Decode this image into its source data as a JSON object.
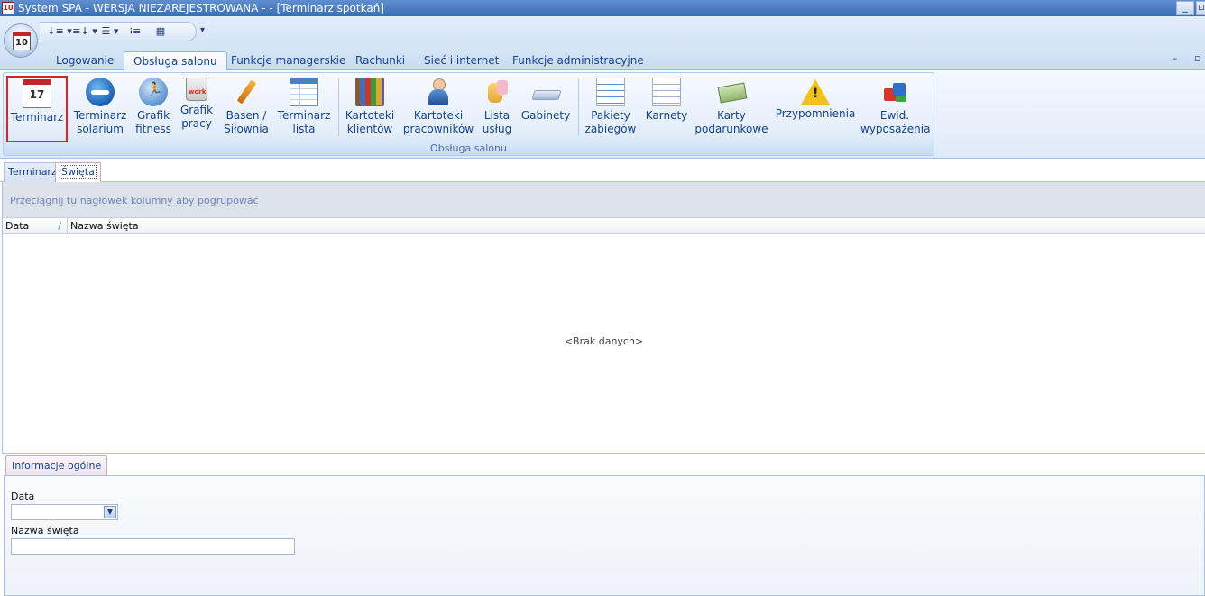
{
  "window": {
    "title": "System SPA - WERSJA NIEZAREJESTROWANA -  - [Terminarz spotkań]",
    "app_icon_text": "10",
    "controls": {
      "minimize": "_",
      "restore": "▫"
    }
  },
  "orb": {
    "day": "10"
  },
  "qat": {
    "buttons": [
      "↓≡ ▾",
      "≡↓ ▾",
      "☰ ▾",
      "⁝≡",
      "▦"
    ],
    "more": "▾"
  },
  "tabs": [
    {
      "label": "Logowanie"
    },
    {
      "label": "Obsługa salonu"
    },
    {
      "label": "Funkcje managerskie"
    },
    {
      "label": "Rachunki"
    },
    {
      "label": "Sieć i internet"
    },
    {
      "label": "Funkcje administracyjne"
    }
  ],
  "tabs_controls": {
    "min": "–",
    "restore": "▫"
  },
  "ribbon": {
    "group_label": "Obsługa salonu",
    "buttons": [
      {
        "label": "Terminarz",
        "icon": "calendar-icon",
        "icon_text": "17"
      },
      {
        "label": "Terminarz solarium",
        "icon": "solarium-icon"
      },
      {
        "label": "Grafik fitness",
        "icon": "runner-icon"
      },
      {
        "label": "Grafik pracy",
        "icon": "work-mug-icon"
      },
      {
        "label": "Basen / Siłownia",
        "icon": "pencil-icon"
      },
      {
        "label": "Terminarz lista",
        "icon": "table-icon"
      },
      {
        "label": "Kartoteki klientów",
        "icon": "books-icon"
      },
      {
        "label": "Kartoteki pracowników",
        "icon": "person-icon"
      },
      {
        "label": "Lista usług",
        "icon": "hand-icon"
      },
      {
        "label": "Gabinety",
        "icon": "bed-icon"
      },
      {
        "label": "Pakiety zabiegów",
        "icon": "checklist-icon"
      },
      {
        "label": "Karnety",
        "icon": "list-icon"
      },
      {
        "label": "Karty podarunkowe",
        "icon": "money-icon"
      },
      {
        "label": "Przypomnienia",
        "icon": "warning-icon"
      },
      {
        "label": "Ewid. wyposażenia",
        "icon": "cubes-icon"
      }
    ]
  },
  "doc_tabs": [
    {
      "label": "Terminarz"
    },
    {
      "label": "Święta"
    }
  ],
  "grid": {
    "group_hint": "Przeciągnij tu nagłówek kolumny aby pogrupować",
    "columns": [
      {
        "label": "Data",
        "sort": "/"
      },
      {
        "label": "Nazwa święta"
      }
    ],
    "empty_text": "<Brak danych>"
  },
  "details": {
    "tab_label": "Informacje ogólne",
    "fields": {
      "date_label": "Data",
      "date_value": "",
      "name_label": "Nazwa święta",
      "name_value": ""
    }
  }
}
